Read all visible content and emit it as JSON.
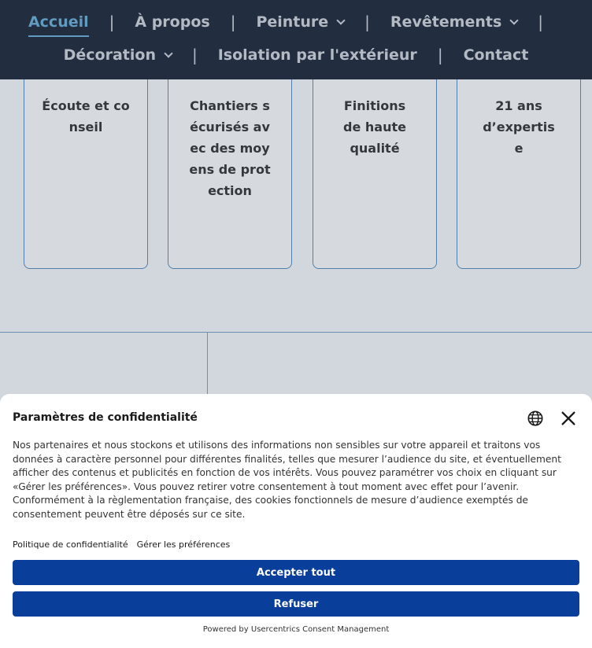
{
  "nav": {
    "row1": [
      {
        "label": "Accueil",
        "active": true,
        "dropdown": false
      },
      {
        "label": "À propos",
        "dropdown": false
      },
      {
        "label": "Peinture",
        "dropdown": true
      },
      {
        "label": "Revêtements",
        "dropdown": true
      }
    ],
    "row2": [
      {
        "label": "Décoration",
        "dropdown": true
      },
      {
        "label": "Isolation par l'extérieur",
        "dropdown": false
      },
      {
        "label": "Contact",
        "dropdown": false
      }
    ],
    "separator": "|"
  },
  "features": [
    {
      "text": "Écoute et conseil"
    },
    {
      "text": "Chantiers sécurisés avec des moyens de protection"
    },
    {
      "text": "Finitions de haute qualité"
    },
    {
      "text": "21 ans d’expertise"
    }
  ],
  "consent": {
    "title": "Paramètres de confidentialité",
    "body": "Nos partenaires et nous stockons et utilisons des informations non sensibles sur votre appareil et traitons vos données à caractère personnel pour différentes finalités, telles que mesurer l’audience du site, et éventuellement afficher des contenus et publicités en fonction de vos intérêts. Vous pouvez paramétrer vos choix en cliquant sur «Gérer les préférences». Vous pouvez retirer votre consentement à tout moment avec effet pour l’avenir. Conformément à la règlementation française, des cookies fonctionnels de mesure d’audience exemptés de consentement peuvent être déposés sur ce site.",
    "privacy_link": "Politique de confidentialité",
    "preferences_link": "Gérer les préférences",
    "accept_label": "Accepter tout",
    "refuse_label": "Refuser",
    "powered_by": "Powered by Usercentrics Consent Management",
    "icons": {
      "language": "globe-icon",
      "close": "close-icon"
    }
  },
  "colors": {
    "nav_bg": "#242c3e",
    "nav_active": "#6fb3d9",
    "button_bg": "#0a3e9b",
    "card_border": "#5e8fc0"
  }
}
